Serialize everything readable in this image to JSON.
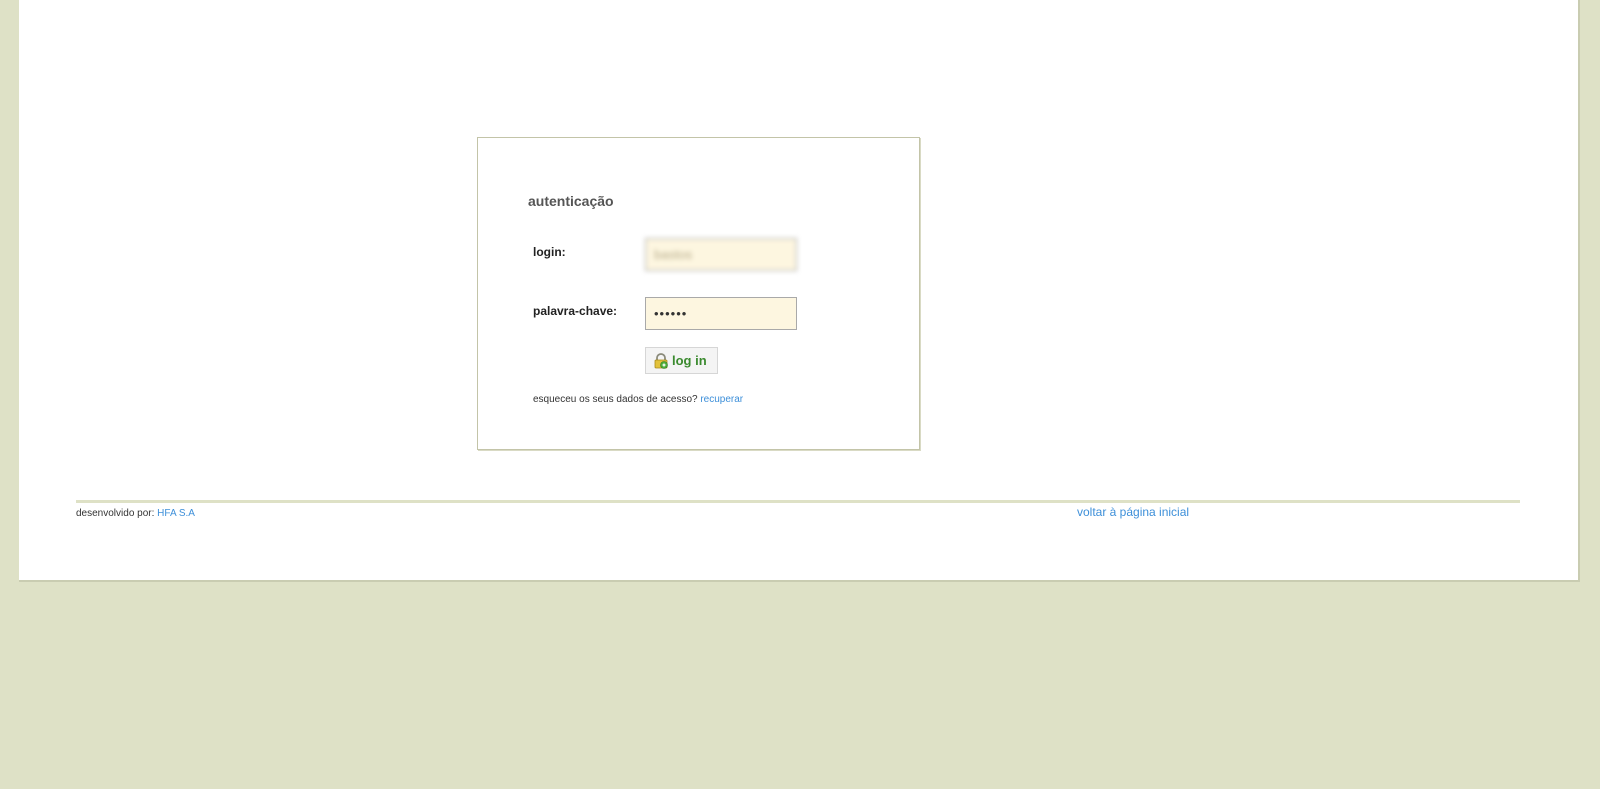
{
  "login_box": {
    "title": "autenticação",
    "login_label": "login:",
    "login_value": "bastos",
    "password_label": "palavra-chave:",
    "password_value": "••••••",
    "button_label": "log in",
    "button_icon": "lock-icon",
    "forgot_text": "esqueceu os seus dados de acesso?",
    "recover_link": "recuperar"
  },
  "footer": {
    "developed_by": "desenvolvido por:",
    "company_link": "HFA S.A",
    "home_link": "voltar à página inicial"
  },
  "colors": {
    "background": "#dee1c6",
    "input_bg": "#fdf6e0",
    "link": "#3d8fd9",
    "button_text": "#3a8a2e"
  }
}
